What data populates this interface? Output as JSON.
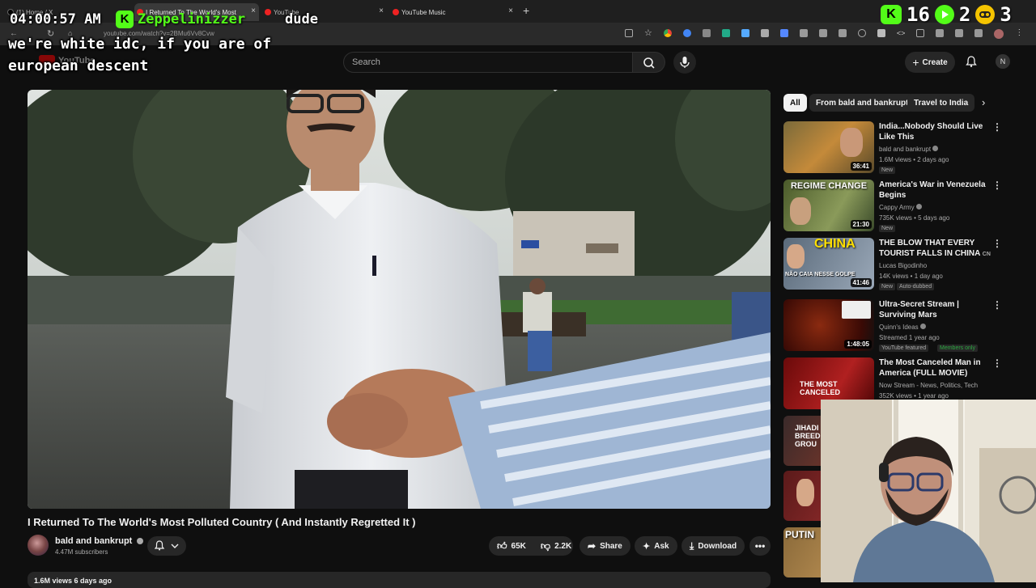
{
  "browser": {
    "tabs": [
      {
        "label": "(1) Home / X"
      },
      {
        "label": "I Returned To The World's Most"
      },
      {
        "label": "YouTube"
      },
      {
        "label": "YouTube Music"
      }
    ],
    "url": "youtube.com/watch?v=2BMu6Vv8Cvw"
  },
  "overlay": {
    "clock": "04:00:57 AM",
    "chat": {
      "username": "Zeppelinizzer",
      "line1": "dude",
      "line2": "we're white idc, if you are of",
      "line3": "european descent"
    },
    "stats": [
      {
        "icon": "kick-icon",
        "value": "16",
        "color": "#53fc18"
      },
      {
        "icon": "play-icon",
        "value": "2",
        "color": "#53fc18"
      },
      {
        "icon": "mask-icon",
        "value": "3",
        "color": "#f5c400"
      }
    ],
    "kick_letter": "K"
  },
  "header": {
    "logo_text": "YouTube",
    "search_placeholder": "Search",
    "create_label": "Create",
    "avatar_letter": "N"
  },
  "video": {
    "title": "I Returned To The World's Most Polluted Country ( And Instantly Regretted It )",
    "channel": "bald and bankrupt",
    "subscribers": "4.47M subscribers",
    "likes": "65K",
    "dislikes": "2.2K",
    "share_label": "Share",
    "ask_label": "Ask",
    "download_label": "Download",
    "views_date": "1.6M views  6 days ago"
  },
  "chips": [
    {
      "label": "All",
      "active": true
    },
    {
      "label": "From bald and bankrupt",
      "active": false
    },
    {
      "label": "Travel to India",
      "active": false
    }
  ],
  "recommendations": [
    {
      "title": "India...Nobody Should Live Like This",
      "channel": "bald and bankrupt",
      "verified": true,
      "meta": "1.6M views • 2 days ago",
      "badge": "New",
      "duration": "36:41"
    },
    {
      "title": "America's War in Venezuela Begins",
      "channel": "Cappy Army",
      "verified": true,
      "meta": "735K views • 5 days ago",
      "badge": "New",
      "duration": "21:30",
      "thumb_text": "REGIME CHANGE"
    },
    {
      "title": "THE BLOW THAT EVERY TOURIST FALLS IN CHINA",
      "title_suffix": "CN",
      "channel": "Lucas Bigodinho",
      "verified": false,
      "meta": "14K views • 1 day ago",
      "badge": "New",
      "badge2": "Auto-dubbed",
      "duration": "41:46",
      "thumb_text": "CHINA",
      "thumb_text2": "NÃO CAIA NESSE GOLPE"
    },
    {
      "title": "Ultra-Secret Stream | Surviving Mars",
      "channel": "Quinn's Ideas",
      "verified": true,
      "meta": "Streamed 1 year ago",
      "badge": "YouTube featured",
      "badge2": "Members only",
      "duration": "1:48:05"
    },
    {
      "title": "The Most Canceled Man in America (FULL MOVIE)",
      "channel": "Now Stream - News, Politics, Tech",
      "verified": false,
      "meta": "352K views • 1 year ago",
      "thumb_text": "THE MOST CANCELED"
    },
    {
      "thumb_text": "JIHADI BREED GROU"
    },
    {
      "thumb_text": ""
    },
    {
      "thumb_text": "PUTIN"
    }
  ]
}
